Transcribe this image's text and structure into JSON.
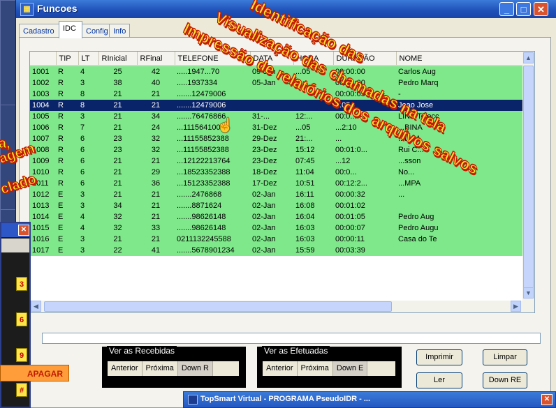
{
  "window": {
    "title": "Funcoes"
  },
  "tabs": [
    "Cadastro",
    "IDC",
    "Config",
    "Info"
  ],
  "columns": [
    "",
    "TIP",
    "LT",
    "RInicial",
    "RFinal",
    "TELEFONE",
    "DATA",
    "HORA",
    "DURAÇÃO",
    "NOME"
  ],
  "rows": [
    [
      "1001",
      "R",
      "4",
      "25",
      "42",
      ".....1947...70",
      "09-Jan",
      "...05",
      "00:00:00",
      "Carlos Aug"
    ],
    [
      "1002",
      "R",
      "3",
      "38",
      "40",
      ".....1937334",
      "05-Jan",
      "...",
      "00:00:00",
      "Pedro Marq"
    ],
    [
      "1003",
      "R",
      "8",
      "21",
      "21",
      ".......12479006",
      "",
      "",
      "00:00:05",
      "-"
    ],
    [
      "1004",
      "R",
      "8",
      "21",
      "21",
      ".......12479006",
      "",
      "",
      "...05",
      "Joao Jose"
    ],
    [
      "1005",
      "R",
      "3",
      "21",
      "34",
      ".......76476866",
      "31-...",
      "12:...",
      "00:0...",
      "LINK Telecc"
    ],
    [
      "1006",
      "R",
      "7",
      "21",
      "24",
      "...11156410000",
      "31-Dez",
      "...05",
      "...2:10",
      "...BINA"
    ],
    [
      "1007",
      "R",
      "6",
      "23",
      "32",
      "...11155852388",
      "29-Dez",
      "21:...",
      "...",
      "...ta M"
    ],
    [
      "1008",
      "R",
      "6",
      "23",
      "32",
      "...11155852388",
      "23-Dez",
      "15:12",
      "00:01:0...",
      "Rui C..."
    ],
    [
      "1009",
      "R",
      "6",
      "21",
      "21",
      "...12122213764",
      "23-Dez",
      "07:45",
      "...12",
      "...sson"
    ],
    [
      "1010",
      "R",
      "6",
      "21",
      "29",
      "...18523352388",
      "18-Dez",
      "11:04",
      "00:0...",
      "No..."
    ],
    [
      "1011",
      "R",
      "6",
      "21",
      "36",
      "...15123352388",
      "17-Dez",
      "10:51",
      "00:12:2...",
      "...MPA"
    ],
    [
      "1012",
      "E",
      "3",
      "21",
      "21",
      ".......2476868",
      "02-Jan",
      "16:11",
      "00:00:32",
      "..."
    ],
    [
      "1013",
      "E",
      "3",
      "34",
      "21",
      ".......8871624",
      "02-Jan",
      "16:08",
      "00:01:02",
      ""
    ],
    [
      "1014",
      "E",
      "4",
      "32",
      "21",
      ".......98626148",
      "02-Jan",
      "16:04",
      "00:01:05",
      "Pedro Aug"
    ],
    [
      "1015",
      "E",
      "4",
      "32",
      "33",
      ".......98626148",
      "02-Jan",
      "16:03",
      "00:00:07",
      "Pedro Augu"
    ],
    [
      "1016",
      "E",
      "3",
      "21",
      "21",
      "0211132245588",
      "02-Jan",
      "16:03",
      "00:00:11",
      "Casa do Te"
    ],
    [
      "1017",
      "E",
      "3",
      "22",
      "41",
      ".......5678901234",
      "02-Jan",
      "15:59",
      "00:03:39",
      ""
    ]
  ],
  "selected_row": "1004",
  "groups": {
    "recebidas": {
      "label": "Ver as Recebidas",
      "buttons": [
        "Anterior",
        "Próxima",
        "Down R"
      ]
    },
    "efetuadas": {
      "label": "Ver as Efetuadas",
      "buttons": [
        "Anterior",
        "Próxima",
        "Down E"
      ]
    }
  },
  "buttons": {
    "imprimir": "Imprimir",
    "limpar": "Limpar",
    "ler": "Ler",
    "downre": "Down RE",
    "apagar": "APAGAR"
  },
  "overlay": {
    "line1": "Identificação das",
    "line2": "Visualização das chamadas na tela",
    "line3": "Impressão de relatórios dos arquivos salvos",
    "line4": "Impressão de relatórios dos arquivos salvos",
    "left_fragments": [
      "a,",
      "agem",
      "clado"
    ]
  },
  "keypad": [
    "3",
    "6",
    "9",
    "#"
  ],
  "taskbar_title": "TopSmart Virtual - PROGRAMA PseudoIDR - ..."
}
